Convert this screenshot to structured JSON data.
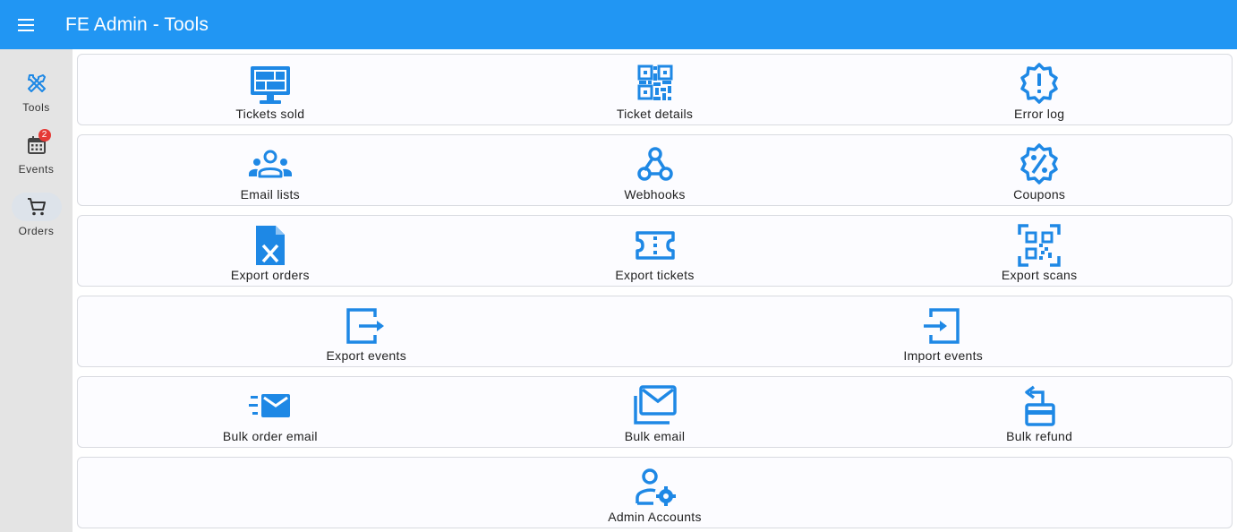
{
  "header": {
    "title": "FE Admin - Tools"
  },
  "rail": {
    "items": [
      {
        "label": "Tools"
      },
      {
        "label": "Events",
        "badge": "2"
      },
      {
        "label": "Orders"
      }
    ]
  },
  "tools": {
    "tickets_sold": "Tickets sold",
    "ticket_details": "Ticket details",
    "error_log": "Error log",
    "email_lists": "Email lists",
    "webhooks": "Webhooks",
    "coupons": "Coupons",
    "export_orders": "Export orders",
    "export_tickets": "Export tickets",
    "export_scans": "Export scans",
    "export_events": "Export events",
    "import_events": "Import events",
    "bulk_order_email": "Bulk order email",
    "bulk_email": "Bulk email",
    "bulk_refund": "Bulk refund",
    "admin_accounts": "Admin Accounts"
  },
  "colors": {
    "primary": "#2196f3",
    "icon": "#1e88e5",
    "badge": "#e53935"
  },
  "icons": {
    "menu": "menu-icon",
    "tools": "tools-icon",
    "events": "calendar-icon",
    "orders": "cart-icon"
  }
}
